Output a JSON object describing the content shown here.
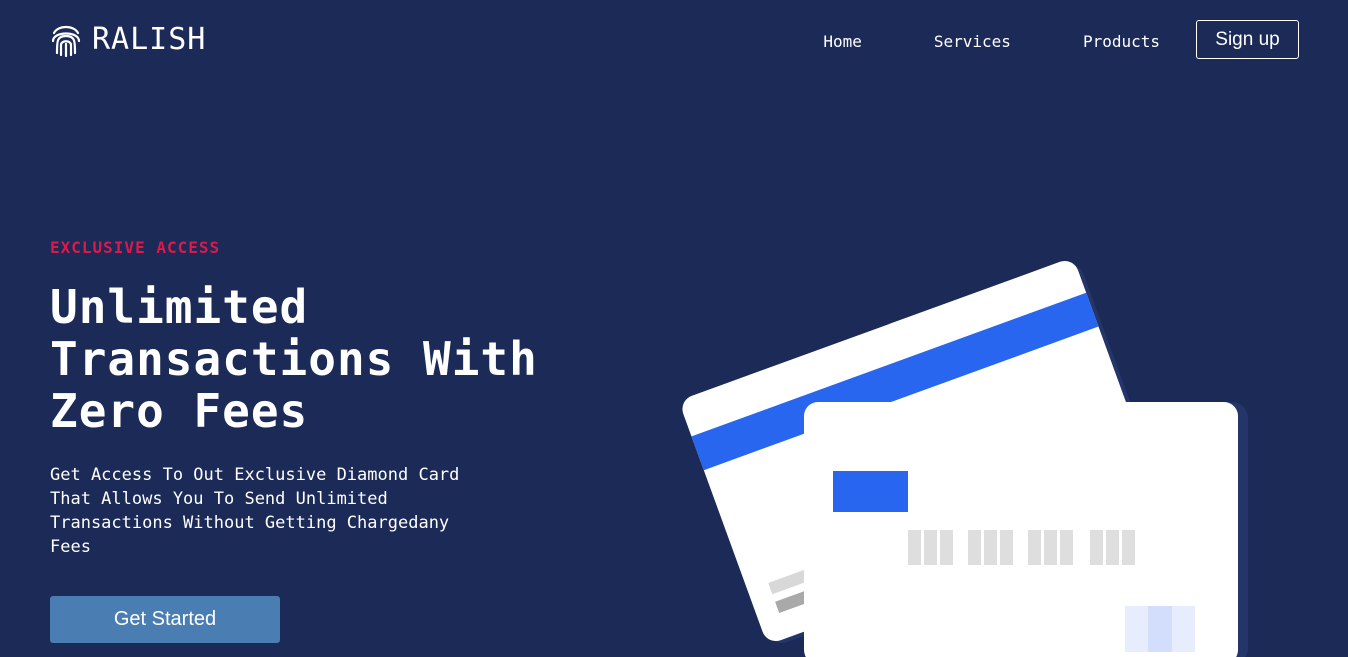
{
  "brand": {
    "name": "RALISH",
    "icon": "fingerprint-icon"
  },
  "nav": {
    "items": [
      "Home",
      "Services",
      "Products"
    ],
    "signup_label": "Sign up"
  },
  "hero": {
    "eyebrow": "EXCLUSIVE ACCESS",
    "title_lines": [
      "Unlimited",
      "Transactions With",
      "Zero Fees"
    ],
    "description": "Get Access To Out Exclusive Diamond Card That Allows You To Send Unlimited Transactions Without Getting Chargedany Fees",
    "cta_label": "Get Started"
  },
  "colors": {
    "background": "#1b2a57",
    "accent": "#e0184a",
    "button": "#4a7eb3",
    "card_stripe": "#2866f0"
  }
}
